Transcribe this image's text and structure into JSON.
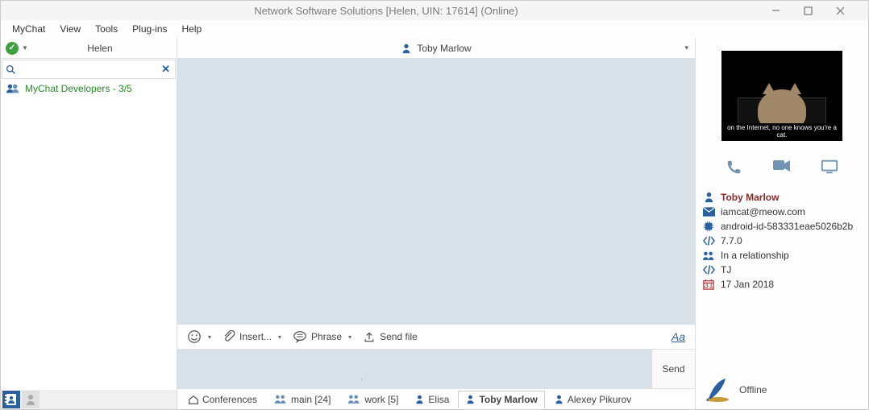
{
  "window": {
    "title": "Network Software Solutions [Helen, UIN: 17614] (Online)"
  },
  "menu": [
    "MyChat",
    "View",
    "Tools",
    "Plug-ins",
    "Help"
  ],
  "left": {
    "user_name": "Helen",
    "search_placeholder": "",
    "channels": [
      {
        "label": "MyChat Developers - 3/5"
      }
    ]
  },
  "center": {
    "conversation_title": "Toby Marlow",
    "toolbar": {
      "insert": "Insert...",
      "phrase": "Phrase",
      "sendfile": "Send file",
      "format": "Aa"
    },
    "send_label": "Send",
    "tabs": [
      {
        "label": "Conferences",
        "icon": "home",
        "active": false
      },
      {
        "label": "main [24]",
        "icon": "group",
        "active": false
      },
      {
        "label": "work [5]",
        "icon": "group",
        "active": false
      },
      {
        "label": "Elisa",
        "icon": "person",
        "active": false
      },
      {
        "label": "Toby Marlow",
        "icon": "person",
        "active": true
      },
      {
        "label": "Alexey Pikurov",
        "icon": "person",
        "active": false
      }
    ]
  },
  "right": {
    "avatar_caption": "on the Internet, no one knows you're a cat.",
    "name": "Toby Marlow",
    "email": "iamcat@meow.com",
    "device": "android-id-583331eae5026b2b",
    "version": "7.7.0",
    "relationship": "In a relationship",
    "tj": "TJ",
    "date": "17 Jan 2018",
    "status": "Offline"
  }
}
